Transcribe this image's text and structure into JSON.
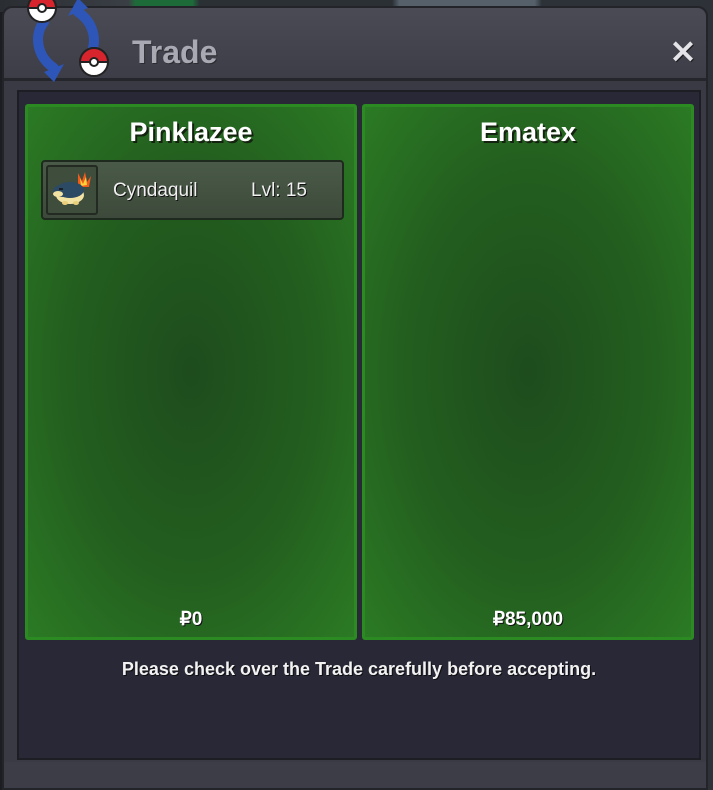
{
  "window": {
    "title": "Trade",
    "close_icon": "×"
  },
  "trade": {
    "left": {
      "player": "Pinklazee",
      "pokemon": [
        {
          "name": "Cyndaquil",
          "level": "Lvl: 15",
          "icon": "cyndaquil-icon"
        }
      ],
      "money": "₽0"
    },
    "right": {
      "player": "Ematex",
      "pokemon": [],
      "money": "₽85,000"
    },
    "notice": "Please check over the Trade carefully before accepting."
  },
  "colors": {
    "panel_border": "#2c8a22",
    "panel_fill": "#235f1f",
    "window_bg": "#282836",
    "title_text": "#a9a9b3"
  }
}
